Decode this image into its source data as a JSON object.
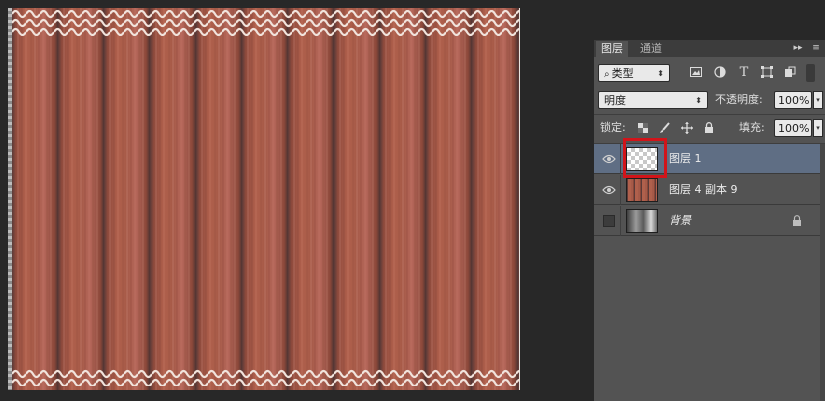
{
  "colors": {
    "canvas_stripe_base": "#a85a48",
    "canvas_stripe_dark": "#5a3a38",
    "wave": "#f1e3dc",
    "highlight_box": "#d2141a",
    "selected_layer": "#5f6e84"
  },
  "layers_panel": {
    "tabs": [
      {
        "label": "图层",
        "active": true
      },
      {
        "label": "通道",
        "active": false
      }
    ],
    "expand_icon_glyph": "▸▸",
    "menu_icon_glyph": "≡",
    "filter": {
      "kind_label": "类型",
      "icons": [
        "image-filter-icon",
        "adjustment-filter-icon",
        "text-filter-icon",
        "shape-filter-icon",
        "smart-object-filter-icon"
      ],
      "text_glyph": "T"
    },
    "blend_mode": "明度",
    "opacity_label": "不透明度:",
    "opacity_value": "100%",
    "lock_label": "锁定:",
    "fill_label": "填充:",
    "fill_value": "100%",
    "layers": [
      {
        "name": "图层 1",
        "visible": true,
        "selected": true,
        "thumbnail": "transparent"
      },
      {
        "name": "图层 4 副本 9",
        "visible": true,
        "selected": false,
        "thumbnail": "wood"
      },
      {
        "name": "背景",
        "visible": false,
        "selected": false,
        "thumbnail": "gradient",
        "locked": true
      }
    ]
  }
}
